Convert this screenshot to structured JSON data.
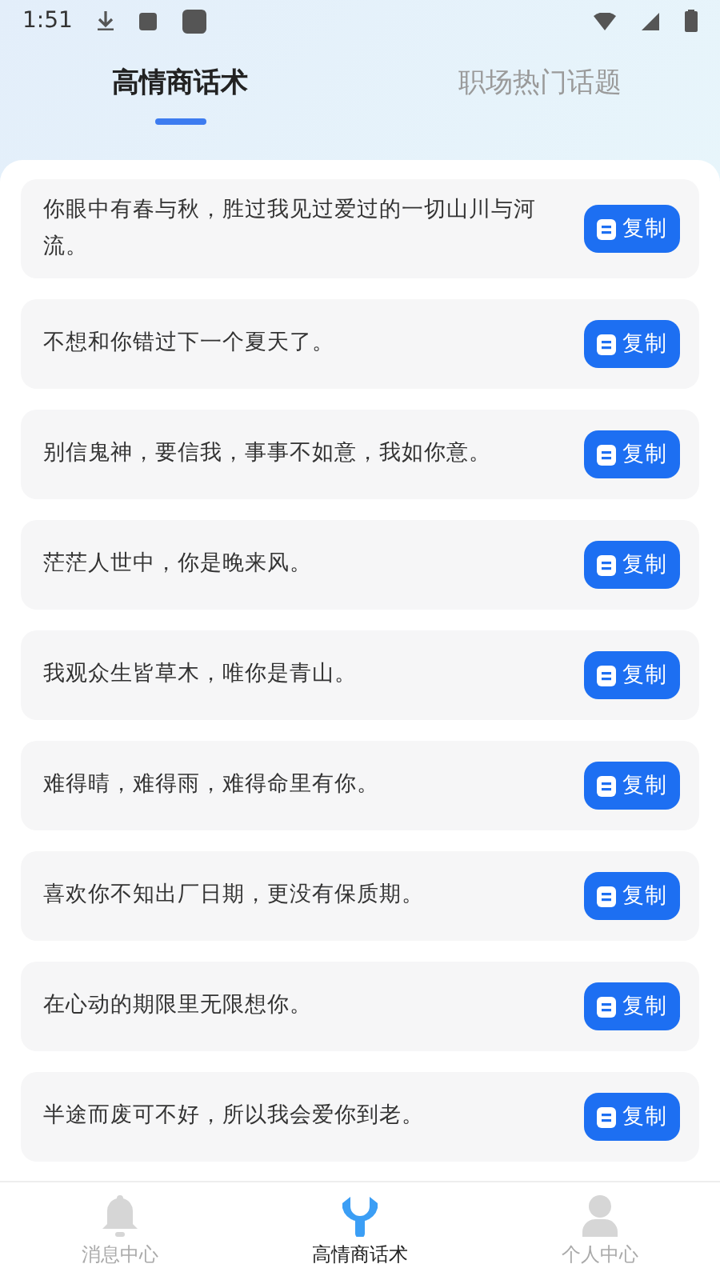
{
  "status_bar": {
    "time": "1:51"
  },
  "tabs": [
    {
      "label": "高情商话术",
      "selected": true
    },
    {
      "label": "职场热门话题",
      "selected": false
    }
  ],
  "phrases": [
    {
      "text": "你眼中有春与秋，胜过我见过爱过的一切山川与河流。",
      "button": "复制"
    },
    {
      "text": "不想和你错过下一个夏天了。",
      "button": "复制"
    },
    {
      "text": "别信鬼神，要信我，事事不如意，我如你意。",
      "button": "复制"
    },
    {
      "text": "茫茫人世中，你是晚来风。",
      "button": "复制"
    },
    {
      "text": "我观众生皆草木，唯你是青山。",
      "button": "复制"
    },
    {
      "text": "难得晴，难得雨，难得命里有你。",
      "button": "复制"
    },
    {
      "text": "喜欢你不知出厂日期，更没有保质期。",
      "button": "复制"
    },
    {
      "text": "在心动的期限里无限想你。",
      "button": "复制"
    },
    {
      "text": "半途而废可不好，所以我会爱你到老。",
      "button": "复制"
    }
  ],
  "bottom_nav": [
    {
      "label": "消息中心",
      "kind": "bell",
      "selected": false
    },
    {
      "label": "高情商话术",
      "kind": "wrench",
      "selected": true
    },
    {
      "label": "个人中心",
      "kind": "person",
      "selected": false
    }
  ]
}
